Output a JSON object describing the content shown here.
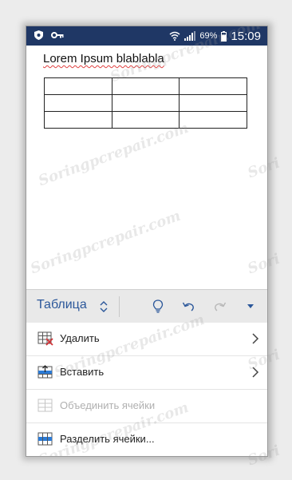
{
  "status_bar": {
    "battery_percent": "69%",
    "time": "15:09"
  },
  "document": {
    "title": "Lorem Ipsum blablabla",
    "table": {
      "rows": 3,
      "cols": 3
    }
  },
  "toolbar": {
    "label": "Таблица"
  },
  "menu": {
    "items": [
      {
        "label": "Удалить",
        "icon": "delete-table-icon",
        "has_submenu": true,
        "enabled": true
      },
      {
        "label": "Вставить",
        "icon": "insert-table-icon",
        "has_submenu": true,
        "enabled": true
      },
      {
        "label": "Объединить ячейки",
        "icon": "merge-cells-icon",
        "has_submenu": false,
        "enabled": false
      },
      {
        "label": "Разделить ячейки...",
        "icon": "split-cells-icon",
        "has_submenu": false,
        "enabled": true
      }
    ]
  },
  "colors": {
    "status_bar": "#1f3765",
    "accent": "#2b579a",
    "delete_red": "#d13438"
  }
}
